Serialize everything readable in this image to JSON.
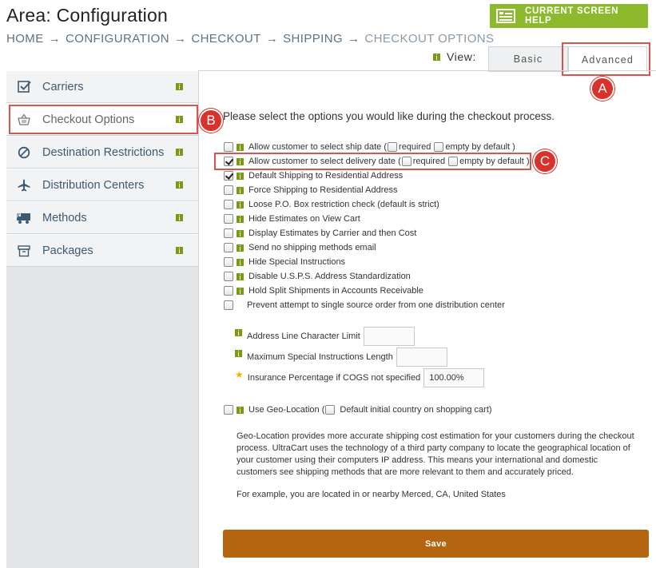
{
  "page": {
    "title": "Area: Configuration",
    "breadcrumb": [
      "HOME",
      "CONFIGURATION",
      "CHECKOUT",
      "SHIPPING",
      "CHECKOUT OPTIONS"
    ],
    "breadcrumb_separator": "→",
    "help_button": "CURRENT SCREEN HELP"
  },
  "view": {
    "label": "View:",
    "basic": "Basic",
    "advanced": "Advanced"
  },
  "callouts": {
    "a": "A",
    "b": "B",
    "c": "C"
  },
  "sidebar": {
    "items": [
      {
        "label": "Carriers",
        "icon": "checkbox-icon"
      },
      {
        "label": "Checkout Options",
        "icon": "basket-icon",
        "active": true
      },
      {
        "label": "Destination Restrictions",
        "icon": "no-entry-icon"
      },
      {
        "label": "Distribution Centers",
        "icon": "airplane-icon"
      },
      {
        "label": "Methods",
        "icon": "truck-icon"
      },
      {
        "label": "Packages",
        "icon": "box-icon"
      }
    ]
  },
  "main": {
    "intro": "Please select the options you would like during the checkout process.",
    "options": [
      {
        "label": "Allow customer to select ship date (",
        "checked": false,
        "sub1": "required",
        "sub2": "empty by default )"
      },
      {
        "label": "Allow customer to select delivery date (",
        "checked": true,
        "sub1": "required",
        "sub2": "empty by default )"
      },
      {
        "label": "Default Shipping to Residential Address",
        "checked": true
      },
      {
        "label": "Force Shipping to Residential Address",
        "checked": false
      },
      {
        "label": "Loose P.O. Box restriction check (default is strict)",
        "checked": false
      },
      {
        "label": "Hide Estimates on View Cart",
        "checked": false
      },
      {
        "label": "Display Estimates by Carrier and then Cost",
        "checked": false
      },
      {
        "label": "Send no shipping methods email",
        "checked": false
      },
      {
        "label": "Hide Special Instructions",
        "checked": false
      },
      {
        "label": "Disable U.S.P.S. Address Standardization",
        "checked": false
      },
      {
        "label": "Hold Split Shipments in Accounts Receivable",
        "checked": false
      },
      {
        "label": "Prevent attempt to single source order from one distribution center",
        "checked": false
      }
    ],
    "fields": {
      "address_limit_label": "Address Line Character Limit",
      "address_limit_value": "",
      "special_len_label": "Maximum Special Instructions Length",
      "special_len_value": "",
      "insurance_label": "Insurance Percentage if COGS not specified",
      "insurance_value": "100.00%"
    },
    "geo": {
      "label": "Use Geo-Location (",
      "sub": "Default initial country on shopping cart)",
      "description": "Geo-Location provides more accurate shipping cost estimation for your customers during the checkout process. UltraCart uses the technology of a third party company to locate the geographical location of your customer using their computers IP address. This means your international and domestic customers see shipping methods that are more relevant to them and accurately priced.",
      "example": "For example, you are located in or nearby Merced, CA, United States"
    },
    "save": "Save"
  },
  "colors": {
    "accent_green": "#8dba2c",
    "save_orange": "#b5650f",
    "callout_red": "#d9322c",
    "nav_text": "#3d5a73"
  }
}
